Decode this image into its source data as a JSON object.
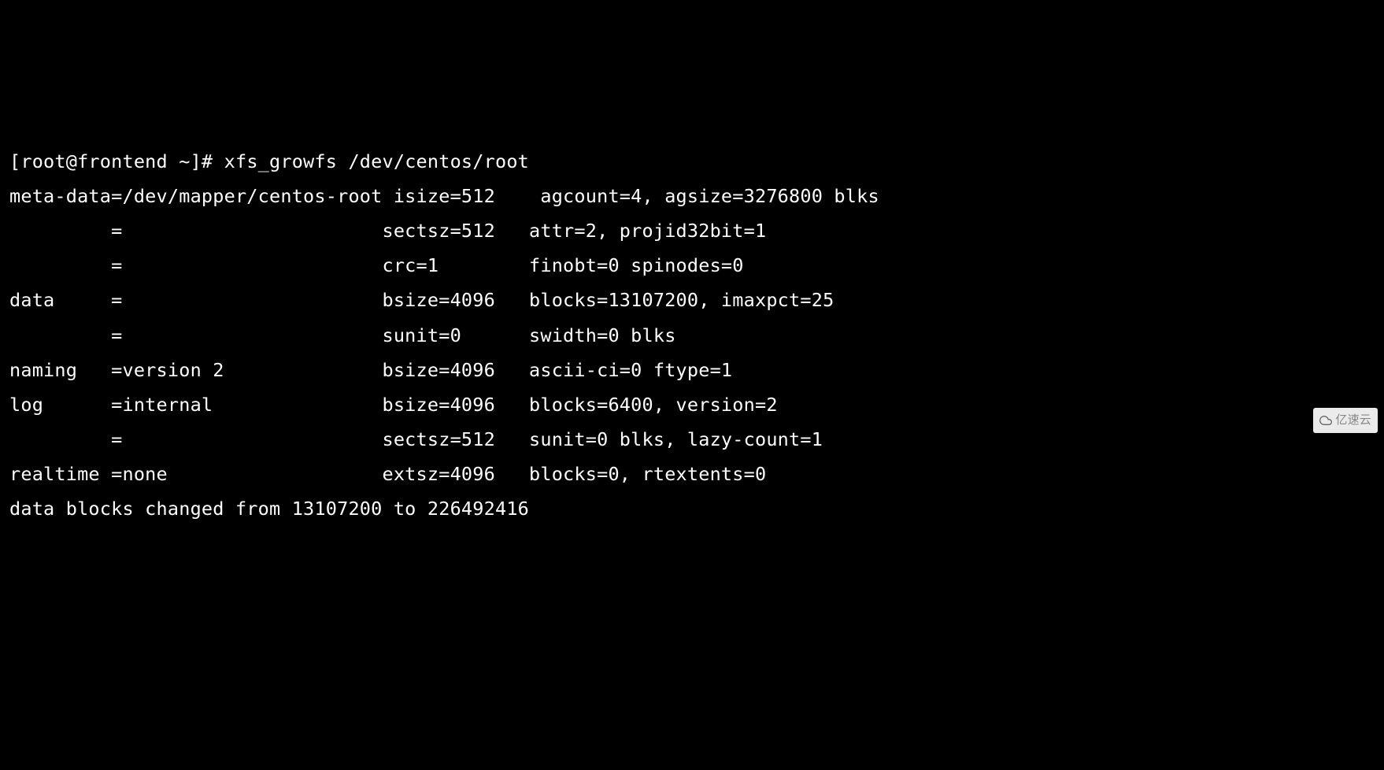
{
  "prompt": "[root@frontend ~]# ",
  "command": "xfs_growfs /dev/centos/root",
  "lines": {
    "l1": "meta-data=/dev/mapper/centos-root isize=512    agcount=4, agsize=3276800 blks",
    "l2": "         =                       sectsz=512   attr=2, projid32bit=1",
    "l3": "         =                       crc=1        finobt=0 spinodes=0",
    "l4": "data     =                       bsize=4096   blocks=13107200, imaxpct=25",
    "l5": "         =                       sunit=0      swidth=0 blks",
    "l6": "naming   =version 2              bsize=4096   ascii-ci=0 ftype=1",
    "l7": "log      =internal               bsize=4096   blocks=6400, version=2",
    "l8": "         =                       sectsz=512   sunit=0 blks, lazy-count=1",
    "l9": "realtime =none                   extsz=4096   blocks=0, rtextents=0",
    "l10": "data blocks changed from 13107200 to 226492416"
  },
  "watermark": "亿速云"
}
